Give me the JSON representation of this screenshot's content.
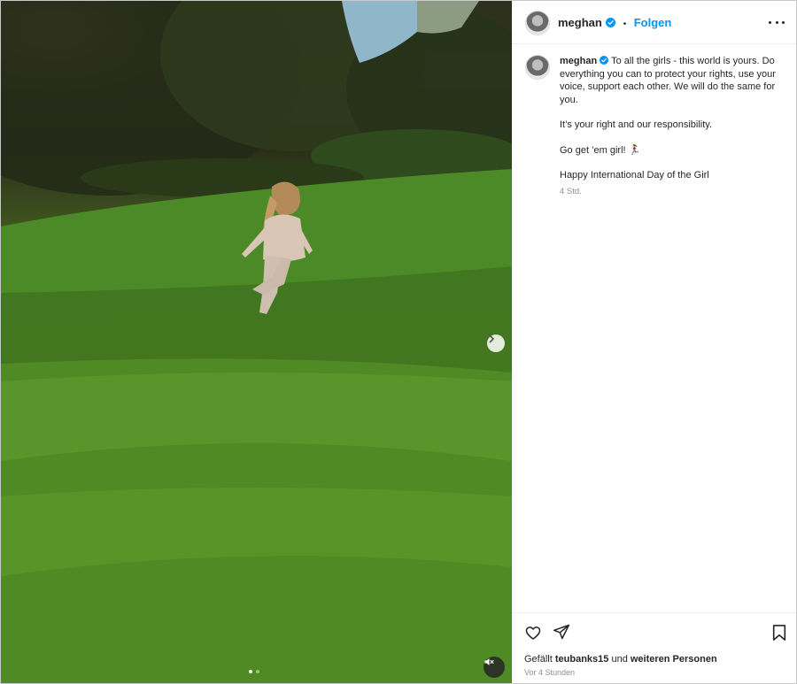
{
  "post": {
    "author": {
      "username": "meghan",
      "verified": true,
      "follow_label": "Folgen",
      "separator": "•"
    },
    "caption": {
      "intro": "To all the girls - this world is yours. Do everything you can to protect your rights, use your voice, support each other. We will do the same for you.",
      "paragraphs": [
        "It’s your right and our responsibility.",
        "Go get ’em girl! 🏃‍♀️",
        "Happy International Day of the Girl"
      ],
      "timestamp": "4 Std."
    },
    "likes": {
      "prefix": "Gefällt",
      "user": "teubanks15",
      "conjunction": "und",
      "suffix": "weiteren Personen"
    },
    "posted_ago": "Vor 4 Stunden"
  },
  "media": {
    "carousel_total": 2,
    "carousel_active": 1,
    "muted": true
  },
  "colors": {
    "follow": "#0095f6",
    "verified": "#0095f6"
  },
  "icons": [
    "heart-icon",
    "share-icon",
    "bookmark-icon",
    "more-options-icon",
    "chevron-right-icon",
    "mute-icon",
    "verified-badge-icon"
  ]
}
